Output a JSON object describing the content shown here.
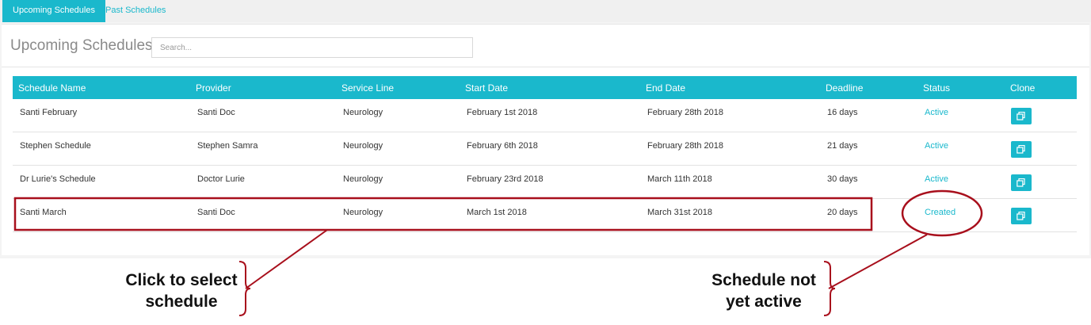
{
  "tabs": [
    {
      "label": "Upcoming Schedules",
      "active": true
    },
    {
      "label": "Past Schedules",
      "active": false
    }
  ],
  "panel": {
    "title": "Upcoming Schedules",
    "search_placeholder": "Search...",
    "search_value": ""
  },
  "table": {
    "columns": [
      "Schedule Name",
      "Provider",
      "Service Line",
      "Start Date",
      "End Date",
      "Deadline",
      "Status",
      "Clone"
    ],
    "rows": [
      {
        "name": "Santi February",
        "provider": "Santi Doc",
        "service_line": "Neurology",
        "start": "February 1st 2018",
        "end": "February 28th 2018",
        "deadline": "16 days",
        "status": "Active"
      },
      {
        "name": "Stephen Schedule",
        "provider": "Stephen Samra",
        "service_line": "Neurology",
        "start": "February 6th 2018",
        "end": "February 28th 2018",
        "deadline": "21 days",
        "status": "Active"
      },
      {
        "name": "Dr Lurie's Schedule",
        "provider": "Doctor Lurie",
        "service_line": "Neurology",
        "start": "February 23rd 2018",
        "end": "March 11th 2018",
        "deadline": "30 days",
        "status": "Active"
      },
      {
        "name": "Santi March",
        "provider": "Santi Doc",
        "service_line": "Neurology",
        "start": "March 1st 2018",
        "end": "March 31st 2018",
        "deadline": "20 days",
        "status": "Created"
      }
    ]
  },
  "annotations": {
    "left_callout": [
      "Click to select",
      "schedule"
    ],
    "right_callout": [
      "Schedule not",
      "yet active"
    ]
  },
  "colors": {
    "accent": "#1ab8cc",
    "annotation": "#a80f1c"
  },
  "icons": {
    "clone": "copy-icon"
  }
}
